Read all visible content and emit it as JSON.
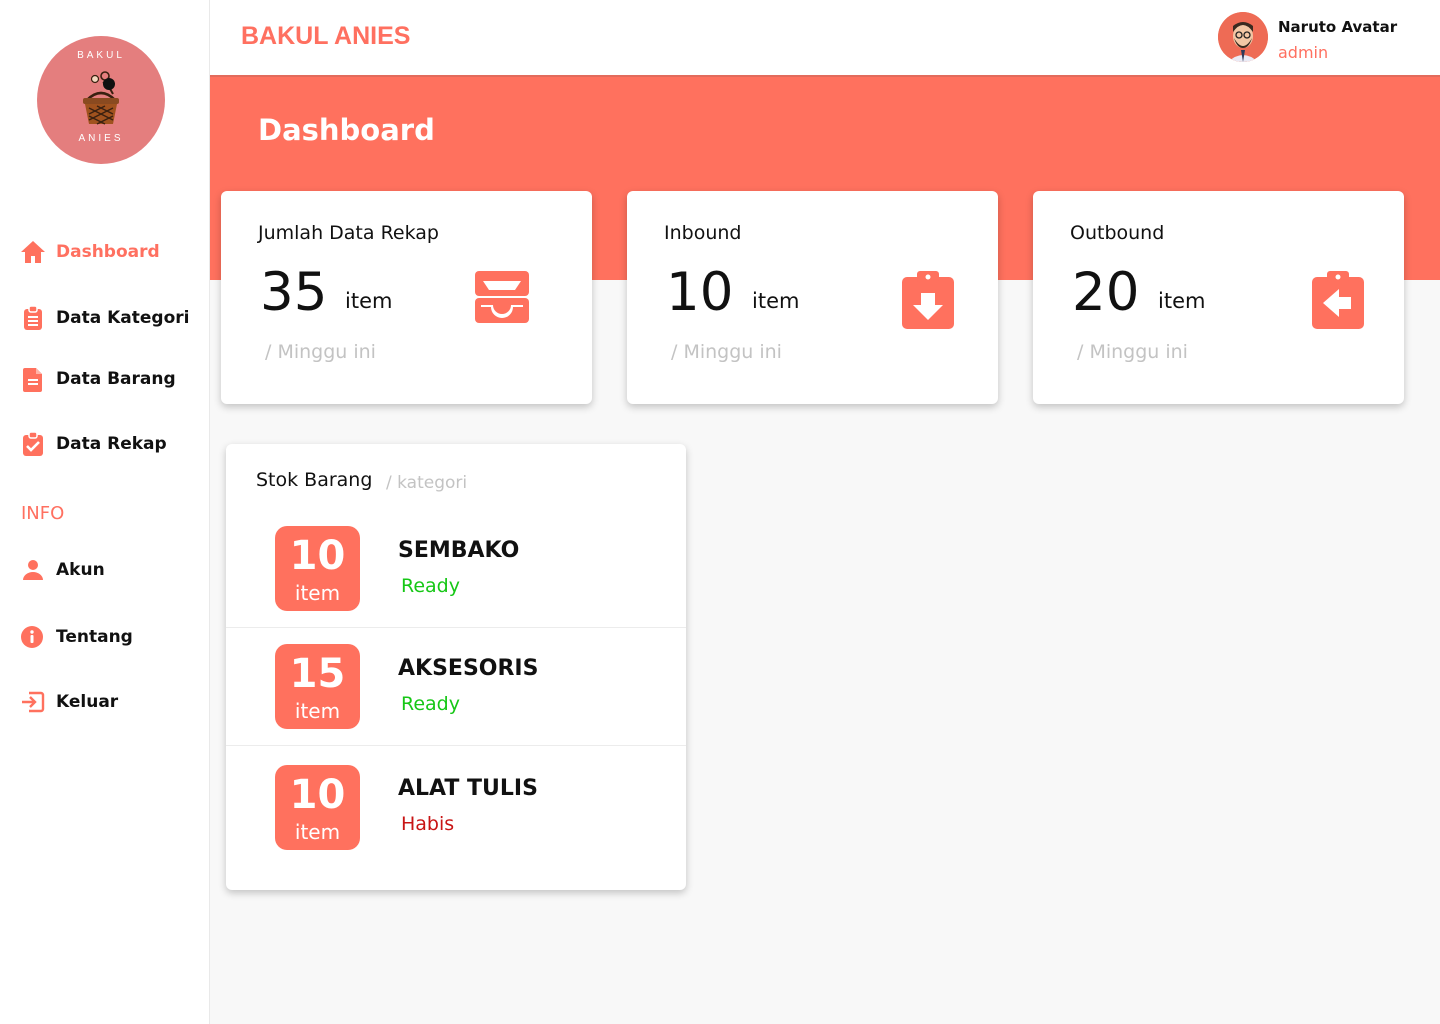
{
  "sidebar": {
    "logo": {
      "top_text": "BAKUL",
      "bottom_text": "ANIES"
    },
    "menu": [
      {
        "label": "Dashboard",
        "icon": "home-icon"
      },
      {
        "label": "Data Kategori",
        "icon": "clipboard-list-icon"
      },
      {
        "label": "Data Barang",
        "icon": "file-text-icon"
      },
      {
        "label": "Data Rekap",
        "icon": "clipboard-check-icon"
      }
    ],
    "section_label": "INFO",
    "info_menu": [
      {
        "label": "Akun",
        "icon": "user-icon"
      },
      {
        "label": "Tentang",
        "icon": "info-icon"
      },
      {
        "label": "Keluar",
        "icon": "logout-icon"
      }
    ]
  },
  "header": {
    "brand": "BAKUL ANIES",
    "user": {
      "name": "Naruto Avatar",
      "role": "admin"
    }
  },
  "page_title": "Dashboard",
  "stats": [
    {
      "title": "Jumlah Data Rekap",
      "value": "35",
      "unit": "item",
      "period": "/ Minggu ini",
      "icon": "inbox-tray-icon"
    },
    {
      "title": "Inbound",
      "value": "10",
      "unit": "item",
      "period": "/ Minggu ini",
      "icon": "clipboard-arrow-down-icon"
    },
    {
      "title": "Outbound",
      "value": "20",
      "unit": "item",
      "period": "/ Minggu ini",
      "icon": "clipboard-arrow-left-icon"
    }
  ],
  "stok": {
    "title": "Stok Barang",
    "subtitle": "/ kategori",
    "rows": [
      {
        "count": "10",
        "unit": "item",
        "name": "SEMBAKO",
        "status": "Ready"
      },
      {
        "count": "15",
        "unit": "item",
        "name": "AKSESORIS",
        "status": "Ready"
      },
      {
        "count": "10",
        "unit": "item",
        "name": "ALAT TULIS",
        "status": "Habis"
      }
    ]
  },
  "colors": {
    "accent": "#ff715e",
    "ready": "#16c716",
    "habis": "#c81414",
    "muted": "#c3c3c3"
  }
}
